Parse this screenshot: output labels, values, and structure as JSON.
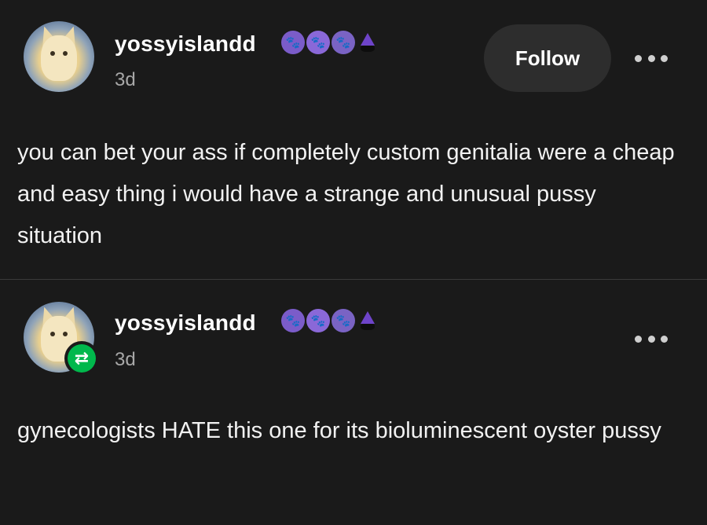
{
  "colors": {
    "background": "#1a1a1a",
    "follow_button_bg": "#2d2d2d",
    "reblog_green": "#00b84c",
    "badge_purple": "#7b5cc9"
  },
  "posts": [
    {
      "username": "yossyislandd",
      "timestamp": "3d",
      "follow_label": "Follow",
      "badges": [
        "orange-paw-badge-icon",
        "pink-paw-badge-icon",
        "gray-paw-badge-icon",
        "witch-cat-badge-icon"
      ],
      "body": "you can bet your ass if completely custom genitalia were a cheap and easy thing i would have a strange and unusual pussy situation"
    },
    {
      "username": "yossyislandd",
      "timestamp": "3d",
      "reblog_icon": "reblog-icon",
      "badges": [
        "orange-paw-badge-icon",
        "pink-paw-badge-icon",
        "gray-paw-badge-icon",
        "witch-cat-badge-icon"
      ],
      "body": "gynecologists HATE this one for its bioluminescent oyster pussy"
    }
  ]
}
